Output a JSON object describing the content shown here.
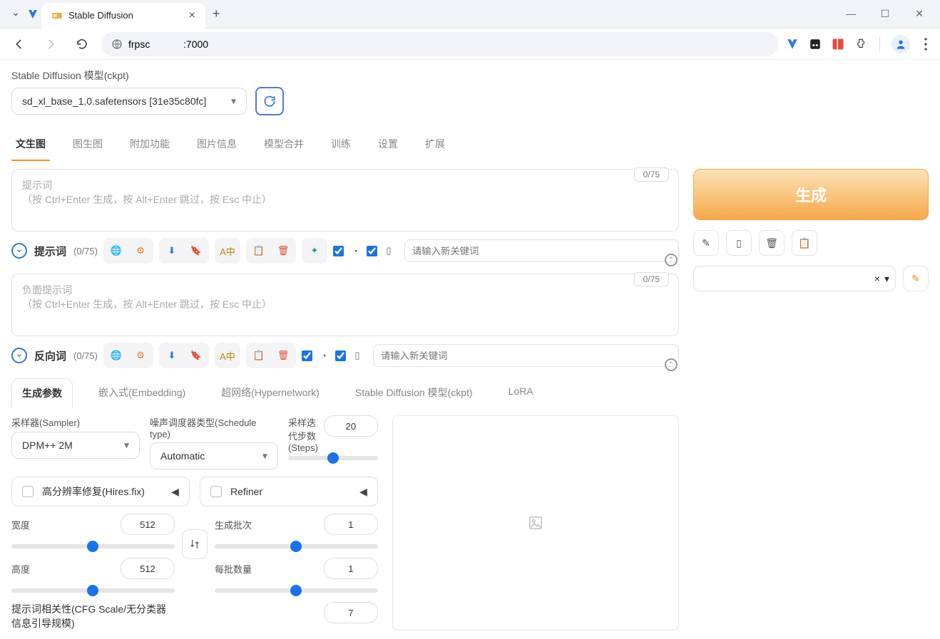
{
  "browser": {
    "tab_title": "Stable Diffusion",
    "url": "frpsc            :7000"
  },
  "header": {
    "model_label": "Stable Diffusion 模型(ckpt)",
    "model_value": "sd_xl_base_1.0.safetensors [31e35c80fc]"
  },
  "tabs": [
    {
      "label": "文生图",
      "active": true
    },
    {
      "label": "图生图"
    },
    {
      "label": "附加功能"
    },
    {
      "label": "图片信息"
    },
    {
      "label": "模型合并"
    },
    {
      "label": "训练"
    },
    {
      "label": "设置"
    },
    {
      "label": "扩展"
    }
  ],
  "prompt": {
    "counter": "0/75",
    "placeholder": "提示词\n（按 Ctrl+Enter 生成，按 Alt+Enter 跳过，按 Esc 中止）",
    "toolbar_title": "提示词",
    "toolbar_count": "(0/75)",
    "keyword_placeholder": "请输入新关键词"
  },
  "neg_prompt": {
    "counter": "0/75",
    "placeholder": "负面提示词\n（按 Ctrl+Enter 生成，按 Alt+Enter 跳过，按 Esc 中止）",
    "toolbar_title": "反向词",
    "toolbar_count": "(0/75)",
    "keyword_placeholder": "请输入新关键词"
  },
  "subtabs": [
    {
      "label": "生成参数",
      "active": true
    },
    {
      "label": "嵌入式(Embedding)"
    },
    {
      "label": "超网络(Hypernetwork)"
    },
    {
      "label": "Stable Diffusion 模型(ckpt)"
    },
    {
      "label": "LoRA"
    }
  ],
  "params": {
    "sampler_label": "采样器(Sampler)",
    "sampler_value": "DPM++ 2M",
    "schedule_label": "噪声调度器类型(Schedule type)",
    "schedule_value": "Automatic",
    "steps_label": "采样迭代步数(Steps)",
    "steps_value": "20",
    "hires_label": "高分辨率修复(Hires.fix)",
    "refiner_label": "Refiner",
    "width_label": "宽度",
    "width_value": "512",
    "height_label": "高度",
    "height_value": "512",
    "batch_count_label": "生成批次",
    "batch_count_value": "1",
    "batch_size_label": "每批数量",
    "batch_size_value": "1",
    "cfg_label": "提示词相关性(CFG Scale/无分类器信息引导规模)",
    "cfg_value": "7"
  },
  "right": {
    "generate": "生成"
  }
}
